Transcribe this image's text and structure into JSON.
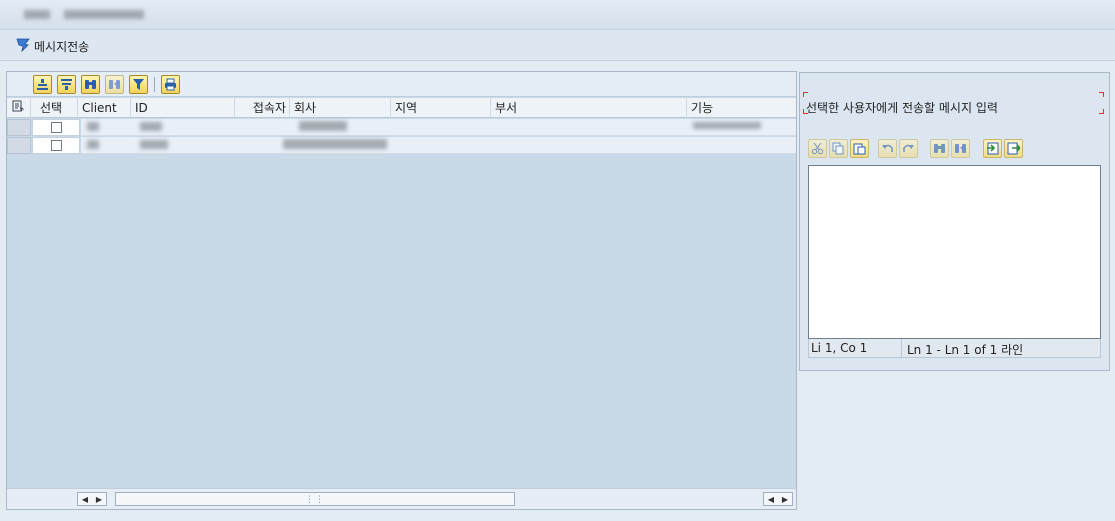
{
  "toolbar": {
    "send_message_label": "메시지전송"
  },
  "grid": {
    "columns": [
      "선택",
      "Client",
      "ID",
      "접속자",
      "회사",
      "지역",
      "부서",
      "기능"
    ],
    "rows": [
      {
        "checked": false
      },
      {
        "checked": false
      }
    ]
  },
  "alv_toolbar": {
    "icons": [
      "sort-ascending-icon",
      "sort-descending-icon",
      "find-icon",
      "find-next-icon",
      "filter-icon",
      "print-icon"
    ]
  },
  "message_panel": {
    "label": "선택한 사용자에게 전송할 메시지 입력",
    "text": "",
    "status_position": "Li 1, Co 1",
    "status_lines": "Ln 1 - Ln 1 of 1 라인",
    "editor_icons": [
      "cut-icon",
      "copy-icon",
      "paste-icon",
      "undo-icon",
      "redo-icon",
      "find-icon",
      "find-next-icon",
      "import-icon",
      "export-icon"
    ]
  },
  "colors": {
    "accent_yellow": "#f2d45e",
    "frame_blue": "#c9d9e8",
    "marker_red": "#dd3333"
  }
}
